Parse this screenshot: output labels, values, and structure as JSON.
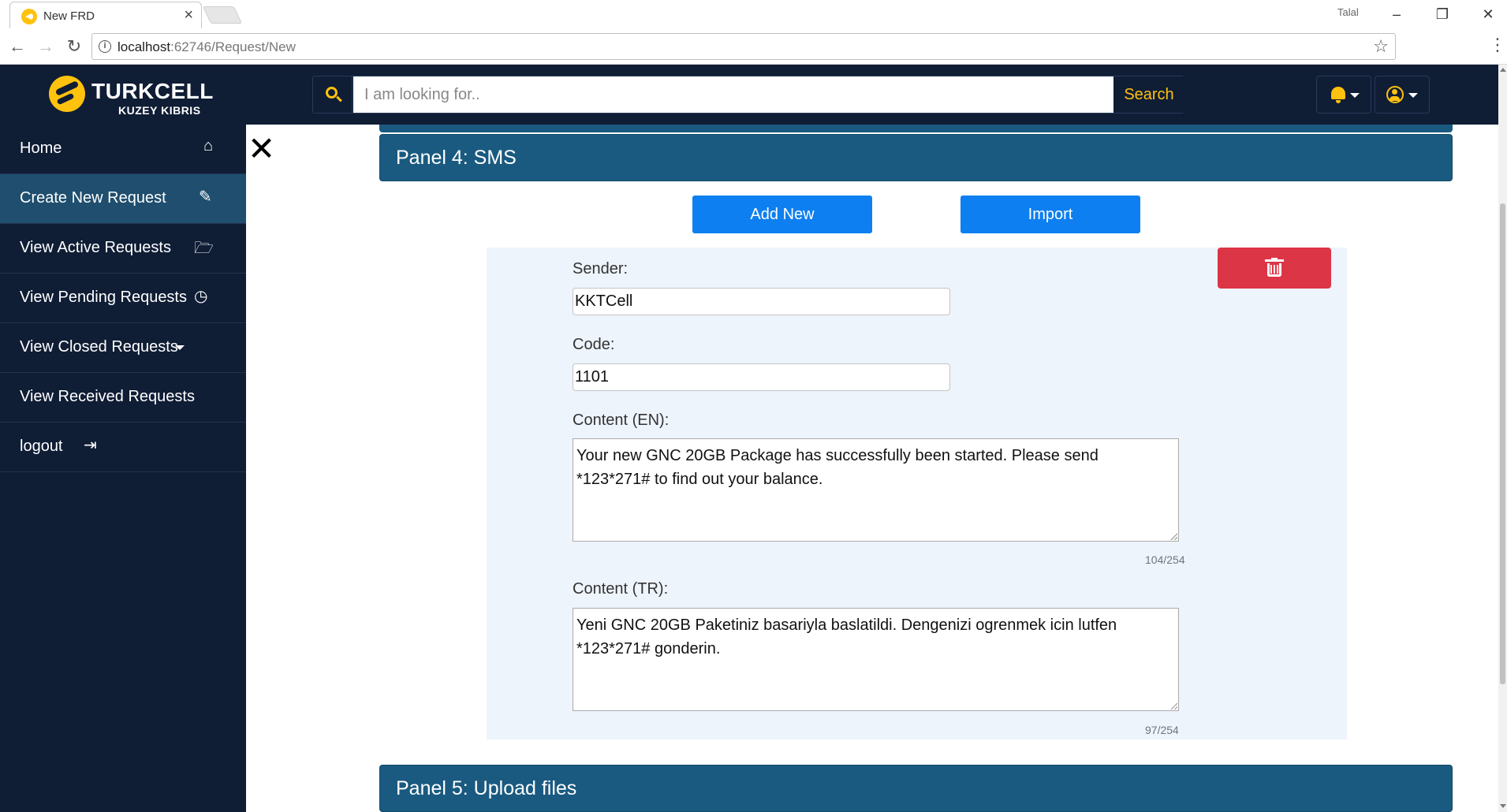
{
  "browser": {
    "tab_title": "New FRD",
    "window_user": "Talal",
    "url_host": "localhost",
    "url_path": ":62746/Request/New"
  },
  "header": {
    "logo_title": "TURKCELL",
    "logo_subtitle": "KUZEY KIBRIS",
    "search_placeholder": "I am looking for..",
    "search_button": "Search",
    "accent_color": "#ffc20e",
    "background_color": "#0f1d35"
  },
  "sidebar": {
    "items": [
      {
        "label": "Home",
        "icon": "home-icon"
      },
      {
        "label": "Create New Request",
        "icon": "edit-icon",
        "active": true
      },
      {
        "label": "View Active Requests",
        "icon": "folder-open-icon"
      },
      {
        "label": "View Pending Requests",
        "icon": "clock-icon"
      },
      {
        "label": "View Closed Requests",
        "icon": "caret-down-icon"
      },
      {
        "label": "View Received Requests",
        "icon": ""
      },
      {
        "label": "logout",
        "icon": "sign-out-icon"
      }
    ]
  },
  "main": {
    "panel4_title": "Panel 4: SMS",
    "add_new_button": "Add New",
    "import_button": "Import",
    "sender_label": "Sender:",
    "sender_value": "KKTCell",
    "code_label": "Code:",
    "code_value": "1101",
    "content_en_label": "Content (EN):",
    "content_en_value": "Your new GNC 20GB Package has successfully been started. Please send *123*271# to find out your balance.",
    "content_en_counter": "104/254",
    "content_tr_label": "Content (TR):",
    "content_tr_value": "Yeni GNC 20GB Paketiniz basariyla baslatildi. Dengenizi ogrenmek icin lutfen *123*271# gonderin.",
    "content_tr_counter": "97/254",
    "panel5_title": "Panel 5: Upload files",
    "panel_color": "#1a5a80",
    "button_color": "#0d7ff0",
    "delete_color": "#dc3545"
  }
}
